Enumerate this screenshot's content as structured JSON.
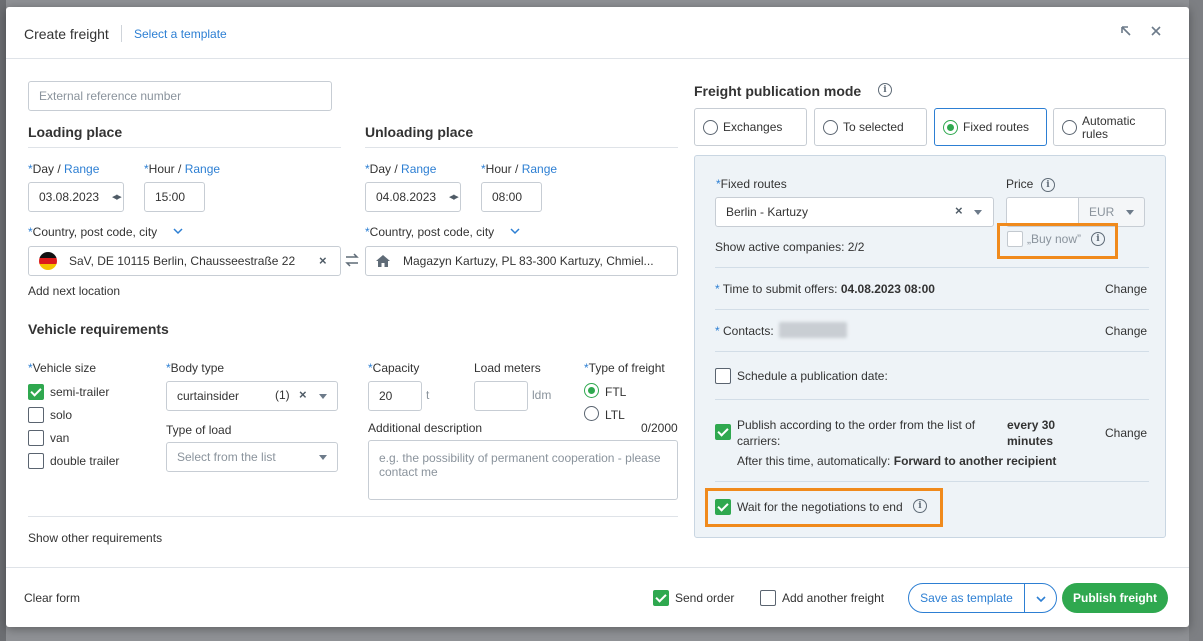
{
  "header": {
    "title": "Create freight",
    "select_template": "Select a template"
  },
  "left": {
    "external_ref_placeholder": "External reference number",
    "loading": {
      "heading": "Loading place",
      "day_label": "Day",
      "range_label": "Range",
      "hour_label": "Hour",
      "day_value": "03.08.2023",
      "hour_value": "15:00",
      "country_label": "Country, post code, city",
      "location": "SaV, DE 10115 Berlin, Chausseestraße 22",
      "add_next_location": "Add next location"
    },
    "unloading": {
      "heading": "Unloading place",
      "day_label": "Day",
      "range_label": "Range",
      "hour_label": "Hour",
      "day_value": "04.08.2023",
      "hour_value": "08:00",
      "country_label": "Country, post code, city",
      "location": "Magazyn Kartuzy, PL 83-300 Kartuzy, Chmiel..."
    },
    "vehicle": {
      "heading": "Vehicle requirements",
      "size_label": "Vehicle size",
      "sizes": [
        "semi-trailer",
        "solo",
        "van",
        "double trailer"
      ],
      "body_type_label": "Body type",
      "body_type_value": "curtainsider",
      "body_type_count": "(1)",
      "type_of_load_label": "Type of load",
      "type_of_load_placeholder": "Select from the list",
      "capacity_label": "Capacity",
      "capacity_value": "20",
      "capacity_unit": "t",
      "load_meters_label": "Load meters",
      "load_meters_unit": "ldm",
      "freight_type_label": "Type of freight",
      "freight_types": [
        "FTL",
        "LTL"
      ],
      "additional_description_label": "Additional description",
      "description_counter": "0/2000",
      "description_placeholder": "e.g. the possibility of permanent cooperation - please contact me",
      "show_other": "Show other requirements"
    }
  },
  "right": {
    "heading": "Freight publication mode",
    "modes": [
      "Exchanges",
      "To selected",
      "Fixed routes",
      "Automatic rules"
    ],
    "fixed_routes_label": "Fixed routes",
    "fixed_routes_value": "Berlin - Kartuzy",
    "price_label": "Price",
    "currency": "EUR",
    "show_active_companies": "Show active companies: 2/2",
    "buy_now": "„Buy now”",
    "time_to_submit_label": "Time to submit offers:",
    "time_to_submit_value": "04.08.2023 08:00",
    "change": "Change",
    "contacts_label": "Contacts:",
    "schedule_label": "Schedule a publication date:",
    "publish_order_label": "Publish according to the order from the list of carriers:",
    "publish_interval": "every 30 minutes",
    "after_time_label": "After this time, automatically:",
    "after_time_value": "Forward to another recipient",
    "wait_negotiations": "Wait for the negotiations to end"
  },
  "footer": {
    "clear_form": "Clear form",
    "send_order": "Send order",
    "add_another": "Add another freight",
    "save_template": "Save as template",
    "publish": "Publish freight"
  },
  "colors": {
    "accent": "#2d7fd3",
    "success": "#2fa84f",
    "highlight": "#f08a1c"
  }
}
